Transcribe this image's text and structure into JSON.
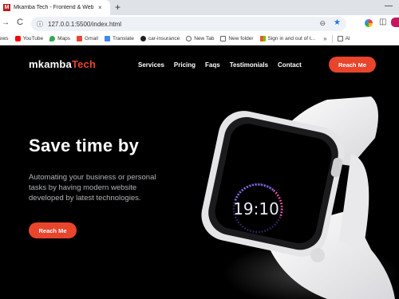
{
  "browser": {
    "tab_favicon": "M",
    "tab_title": "Mkamba Tech - Frontend & Web",
    "tab_close": "×",
    "new_tab": "+",
    "minimize": "—",
    "back": "→",
    "reload": "C",
    "site_info": "ⓘ",
    "url": "127.0.0.1:5500/index.html",
    "zoom": "⊖",
    "star": "★",
    "puzzle": "◫",
    "bookmarks_more": "»",
    "all_bookmarks": "Al",
    "bookmarks": [
      {
        "label": "ews",
        "color": "#5f6368"
      },
      {
        "label": "YouTube",
        "color": "#ff0000"
      },
      {
        "label": "Maps",
        "color": "#34a853"
      },
      {
        "label": "Gmail",
        "color": "#ea4335"
      },
      {
        "label": "Translate",
        "color": "#4285f4"
      },
      {
        "label": "car-insurance",
        "color": "#202124"
      },
      {
        "label": "New Tab",
        "color": "#5f6368"
      },
      {
        "label": "New folder",
        "color": "#5f6368"
      },
      {
        "label": "Sign in and out of t...",
        "color": "#f25022"
      }
    ]
  },
  "site": {
    "logo_part1": "mkamba",
    "logo_part2": "Tech",
    "nav": [
      "Services",
      "Pricing",
      "Faqs",
      "Testimonials",
      "Contact"
    ],
    "top_button": "Reach Me",
    "hero_title": "Save time by",
    "hero_text": "Automating your business or personal tasks by having modern website developed by latest technologies.",
    "hero_button": "Reach Me",
    "watch_time": "19:10"
  },
  "colors": {
    "accent": "#e8452c",
    "background": "#000000",
    "watch_band": "#f4f4f6"
  }
}
